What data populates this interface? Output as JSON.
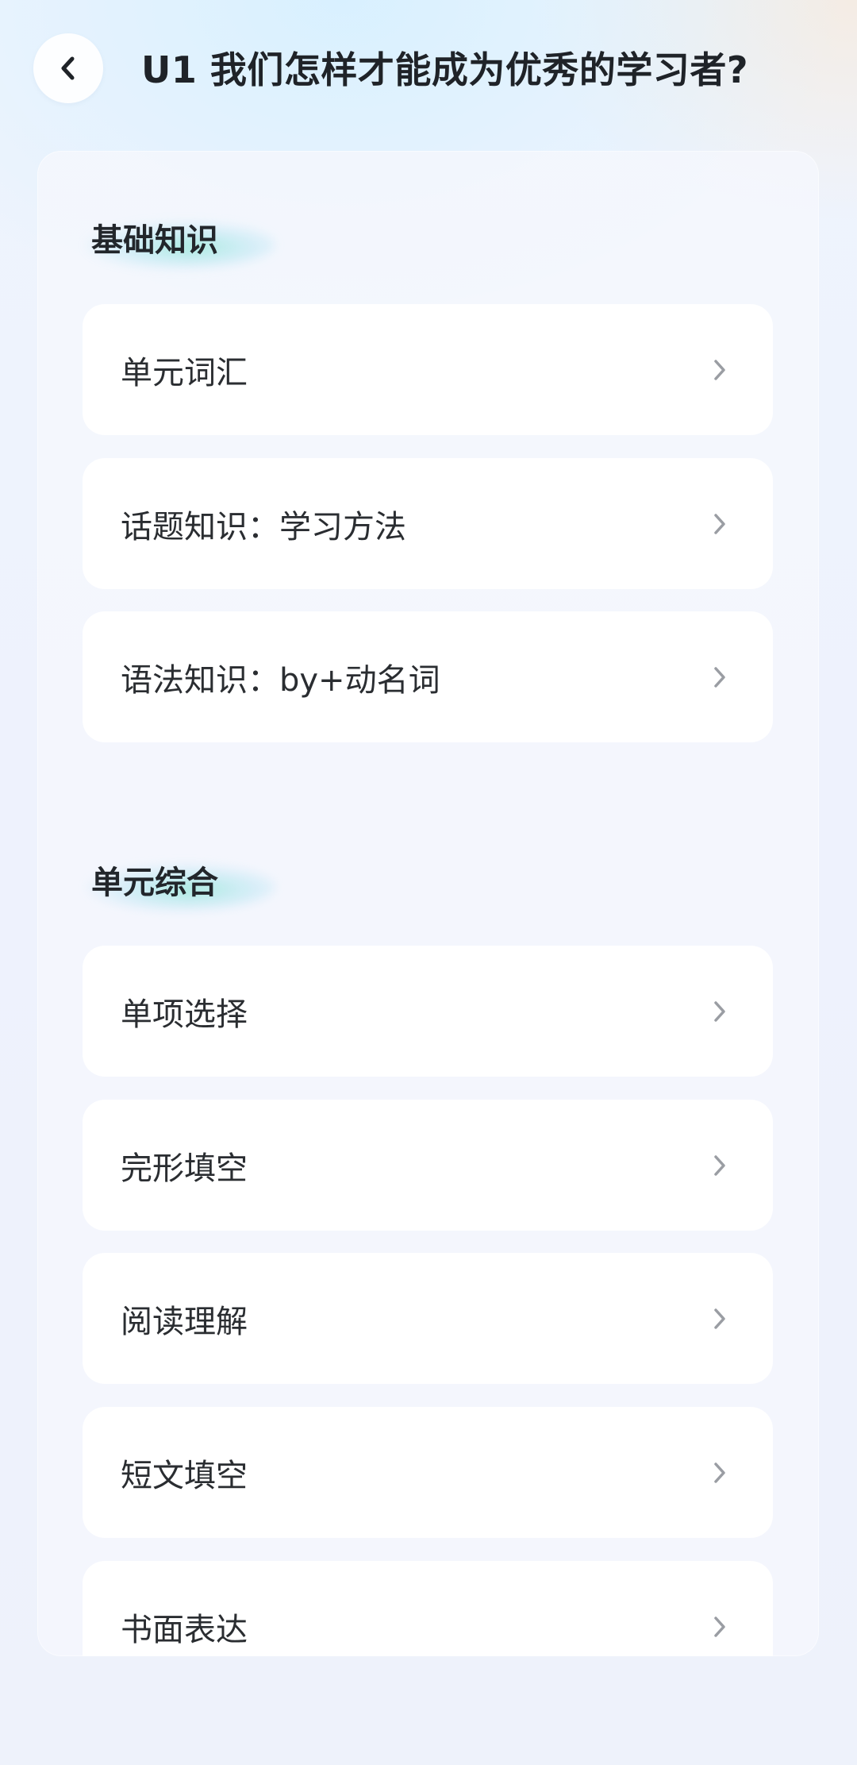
{
  "header": {
    "title": "U1 我们怎样才能成为优秀的学习者?",
    "back_icon": "chevron-left-icon"
  },
  "sections": [
    {
      "title": "基础知识",
      "items": [
        {
          "label": "单元词汇"
        },
        {
          "label": "话题知识：学习方法"
        },
        {
          "label": "语法知识：by+动名词"
        }
      ]
    },
    {
      "title": "单元综合",
      "items": [
        {
          "label": "单项选择"
        },
        {
          "label": "完形填空"
        },
        {
          "label": "阅读理解"
        },
        {
          "label": "短文填空"
        },
        {
          "label": "书面表达"
        }
      ]
    }
  ],
  "colors": {
    "accent_glow": "#6ee1c8",
    "text_primary": "#1f2328",
    "chevron": "#9a9da3"
  },
  "item_icon": "chevron-right-icon"
}
